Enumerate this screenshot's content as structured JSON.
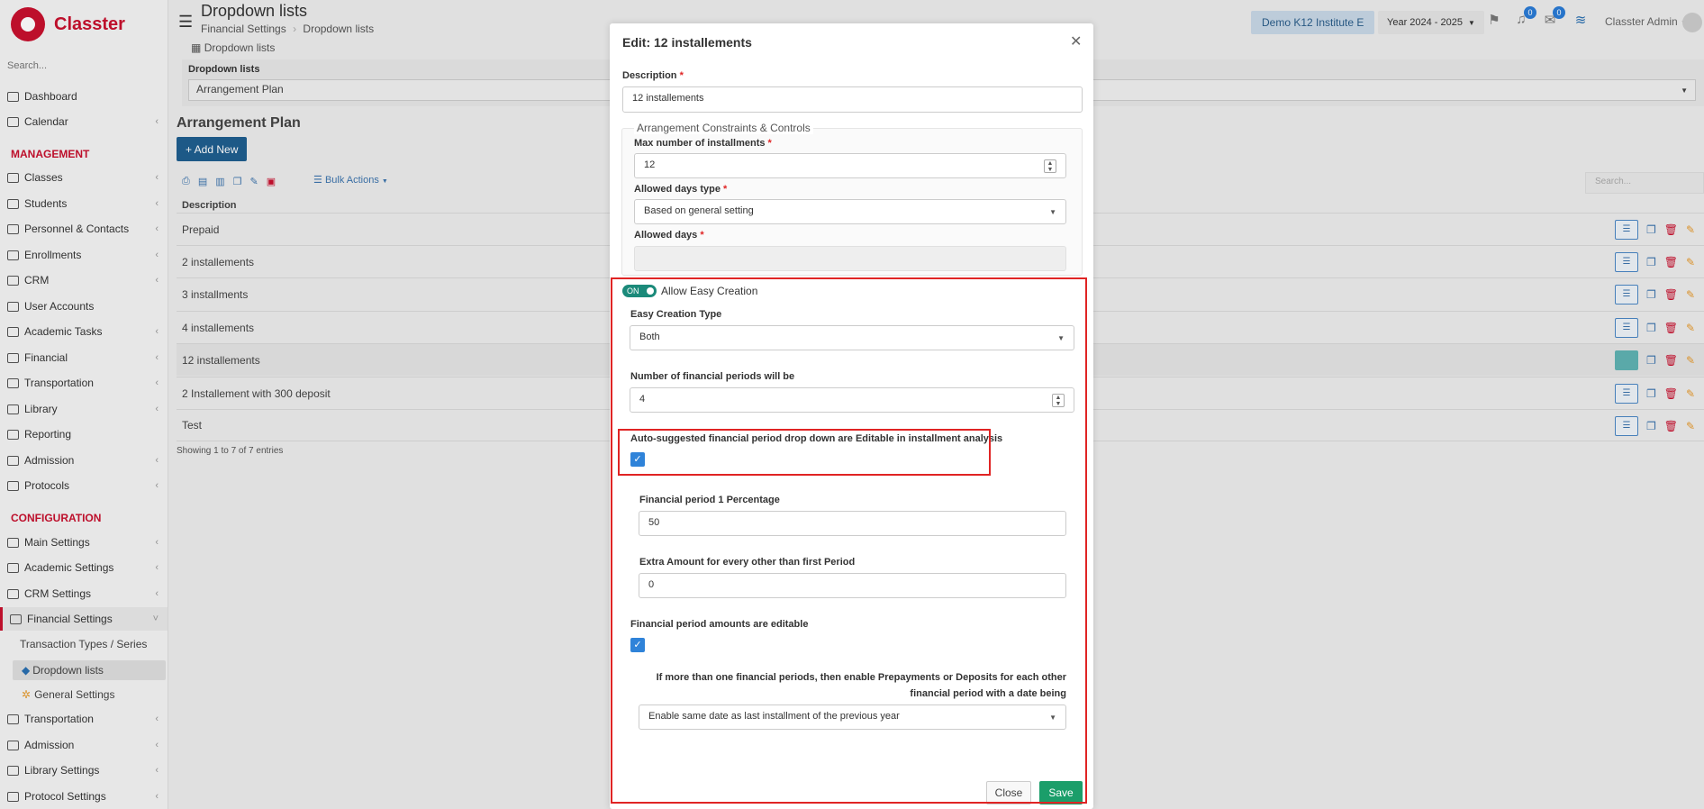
{
  "app": {
    "name": "Classter"
  },
  "sidebar": {
    "search_placeholder": "Search...",
    "items": [
      {
        "label": "Dashboard"
      },
      {
        "label": "Calendar"
      },
      {
        "label": "Classes"
      },
      {
        "label": "Students"
      },
      {
        "label": "Personnel & Contacts"
      },
      {
        "label": "Enrollments"
      },
      {
        "label": "CRM"
      },
      {
        "label": "User Accounts"
      },
      {
        "label": "Academic Tasks"
      },
      {
        "label": "Financial"
      },
      {
        "label": "Transportation"
      },
      {
        "label": "Library"
      },
      {
        "label": "Reporting"
      },
      {
        "label": "Admission"
      },
      {
        "label": "Protocols"
      }
    ],
    "management_header": "MANAGEMENT",
    "configuration_header": "CONFIGURATION",
    "config_items": [
      {
        "label": "Main Settings"
      },
      {
        "label": "Academic Settings"
      },
      {
        "label": "CRM Settings"
      },
      {
        "label": "Financial Settings"
      }
    ],
    "financial_sub": [
      {
        "label": "Transaction Types / Series"
      },
      {
        "label": "Dropdown lists"
      },
      {
        "label": "General Settings"
      }
    ],
    "config_items_after": [
      {
        "label": "Transportation"
      },
      {
        "label": "Admission"
      },
      {
        "label": "Library Settings"
      },
      {
        "label": "Protocol Settings"
      }
    ]
  },
  "header": {
    "title": "Dropdown lists",
    "breadcrumb": [
      "Financial Settings",
      "Dropdown lists"
    ],
    "institute": "Demo K12 Institute E",
    "year": "Year 2024 - 2025",
    "notifications_count": "0",
    "messages_count": "0",
    "user": "Classter Admin"
  },
  "main": {
    "tab": "Dropdown lists",
    "filter_label": "Dropdown lists",
    "filter_value": "Arrangement Plan",
    "section_title": "Arrangement Plan",
    "add_new": "+ Add New",
    "bulk_actions": "Bulk Actions",
    "search_placeholder": "Search...",
    "column_description": "Description",
    "rows": [
      {
        "description": "Prepaid"
      },
      {
        "description": "2 installements"
      },
      {
        "description": "3 installments"
      },
      {
        "description": "4 installements"
      },
      {
        "description": "12 installements"
      },
      {
        "description": "2 Installement with 300 deposit"
      },
      {
        "description": "Test"
      }
    ],
    "showing": "Showing 1 to 7 of 7 entries"
  },
  "modal": {
    "title": "Edit: 12 installements",
    "description_label": "Description",
    "description_value": "12 installements",
    "fieldset_legend": "Arrangement Constraints & Controls",
    "max_installments_label": "Max number of installments",
    "max_installments_value": "12",
    "allowed_days_type_label": "Allowed days type",
    "allowed_days_type_value": "Based on general setting",
    "allowed_days_label": "Allowed days",
    "toggle_state": "ON",
    "toggle_label": "Allow Easy Creation",
    "easy_creation_type_label": "Easy Creation Type",
    "easy_creation_type_value": "Both",
    "num_periods_label": "Number of financial periods will be",
    "num_periods_value": "4",
    "autosuggest_label": "Auto-suggested financial period drop down are Editable in installment analysis",
    "autosuggest_checked": true,
    "period1_label": "Financial period 1 Percentage",
    "period1_value": "50",
    "extra_amount_label": "Extra Amount for every other than first Period",
    "extra_amount_value": "0",
    "amounts_editable_label": "Financial period amounts are editable",
    "amounts_editable_checked": true,
    "prepay_label_line1": "If more than one financial periods, then enable Prepayments or Deposits for each other",
    "prepay_label_line2": "financial period with a date being",
    "prepay_value": "Enable same date as last installment of the previous year",
    "close_button": "Close",
    "save_button": "Save"
  },
  "colors": {
    "brand": "#c8102e",
    "primary": "#1f5e8f",
    "save": "#1b9e6a",
    "highlight": "#e02424"
  }
}
